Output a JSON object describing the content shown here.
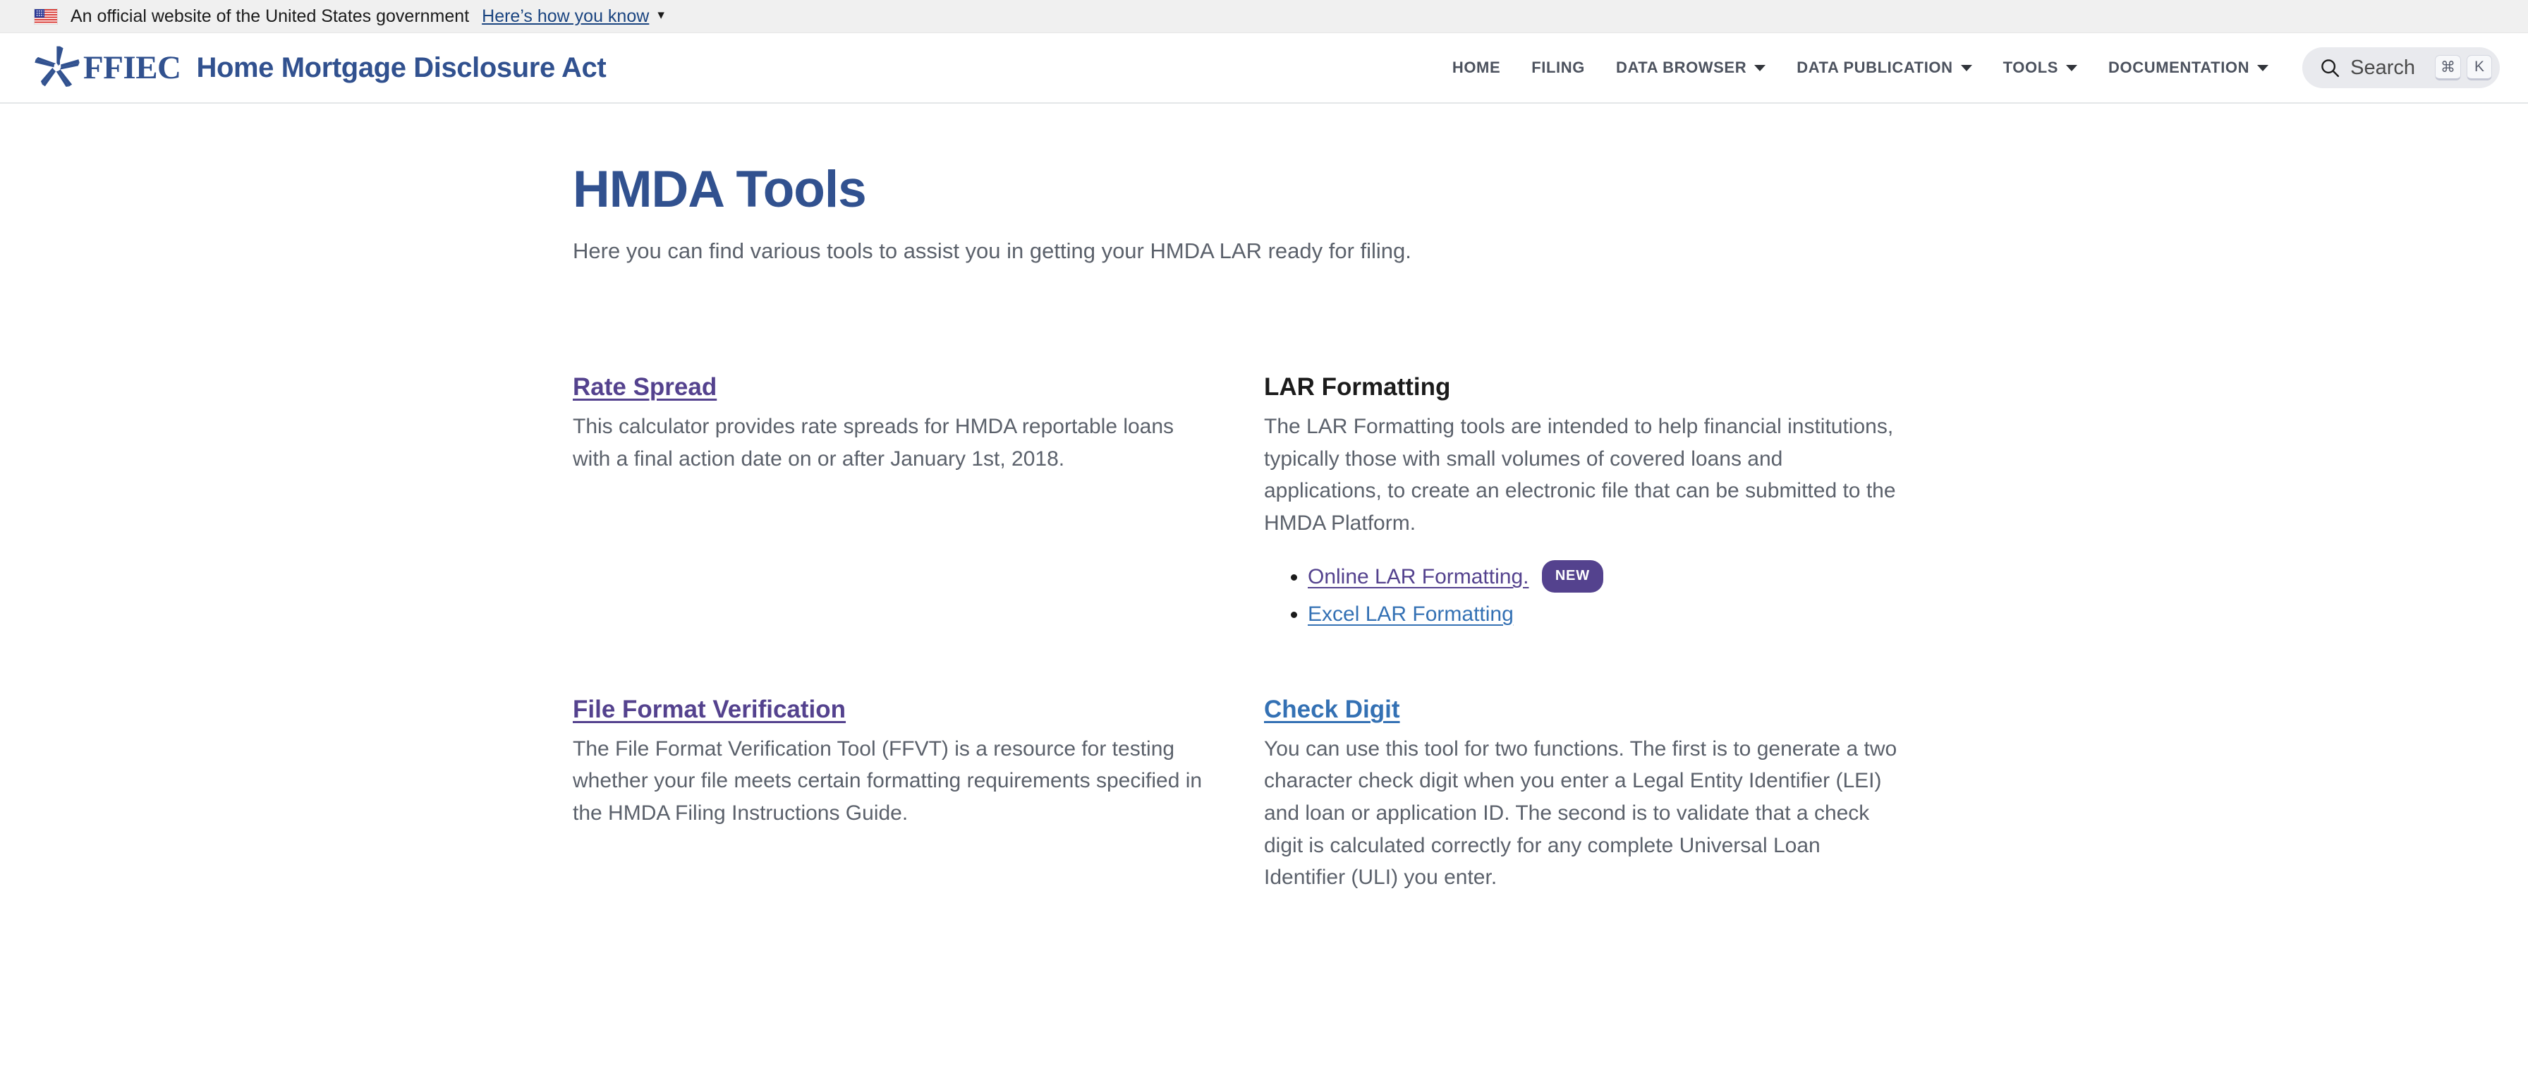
{
  "gov_banner": {
    "text": "An official website of the United States government",
    "link_label": "Here’s how you know",
    "flag_icon": "us-flag-icon",
    "chevron_icon": "chevron-down-icon"
  },
  "header": {
    "logo_icon": "ffiec-star-logo-icon",
    "logo_text": "FFIEC",
    "site_title": "Home Mortgage Disclosure Act",
    "nav": [
      {
        "label": "HOME",
        "has_caret": false
      },
      {
        "label": "FILING",
        "has_caret": false
      },
      {
        "label": "DATA BROWSER",
        "has_caret": true
      },
      {
        "label": "DATA PUBLICATION",
        "has_caret": true
      },
      {
        "label": "TOOLS",
        "has_caret": true
      },
      {
        "label": "DOCUMENTATION",
        "has_caret": true
      }
    ],
    "search": {
      "icon": "search-icon",
      "label": "Search",
      "shortcut_modifier": "⌘",
      "shortcut_key": "K"
    }
  },
  "main": {
    "title": "HMDA Tools",
    "intro": "Here you can find various tools to assist you in getting your HMDA LAR ready for filing.",
    "tools": [
      {
        "heading": "Rate Spread",
        "heading_style": "link-purple",
        "description": "This calculator provides rate spreads for HMDA reportable loans with a final action date on or after January 1st, 2018."
      },
      {
        "heading": "LAR Formatting",
        "heading_style": "plain",
        "description": "The LAR Formatting tools are intended to help financial institutions, typically those with small volumes of covered loans and applications, to create an electronic file that can be submitted to the HMDA Platform.",
        "links": [
          {
            "label": "Online LAR Formatting.",
            "style": "inline-link-purple",
            "badge": "NEW"
          },
          {
            "label": "Excel LAR Formatting",
            "style": "inline-link-blue",
            "badge": null
          }
        ]
      },
      {
        "heading": "File Format Verification",
        "heading_style": "link-purple",
        "description": "The File Format Verification Tool (FFVT) is a resource for testing whether your file meets certain formatting requirements specified in the HMDA Filing Instructions Guide."
      },
      {
        "heading": "Check Digit",
        "heading_style": "link-blue",
        "description": "You can use this tool for two functions. The first is to generate a two character check digit when you enter a Legal Entity Identifier (LEI) and loan or application ID. The second is to validate that a check digit is calculated correctly for any complete Universal Loan Identifier (ULI) you enter."
      }
    ]
  },
  "colors": {
    "brand_navy": "#31518f",
    "link_purple": "#54428e",
    "link_blue": "#3471b4",
    "body_gray": "#5b616b",
    "banner_bg": "#f0f0f0"
  }
}
